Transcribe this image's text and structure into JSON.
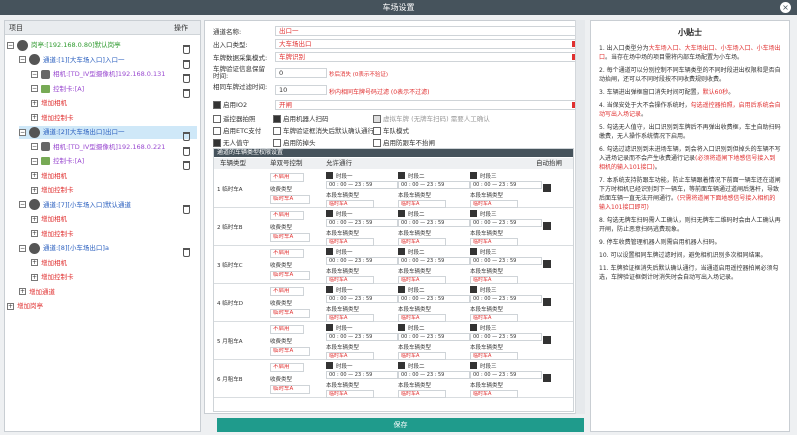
{
  "window": {
    "title": "车场设置",
    "close": "×"
  },
  "left": {
    "col_item": "项目",
    "col_op": "操作",
    "nodes": [
      {
        "text": "岗亭:[192.168.0.80]默认岗亭",
        "color": "green",
        "indent": 0,
        "icon": "booth"
      },
      {
        "text": "通道:[1][大车场入口]入口一",
        "color": "blue",
        "indent": 1,
        "icon": "gate"
      },
      {
        "text": "相机:[TD_IV型摄像机]192.168.0.131",
        "color": "purple",
        "indent": 2,
        "icon": "camera"
      },
      {
        "text": "控制卡:[A]",
        "color": "purple",
        "indent": 2,
        "icon": "card"
      },
      {
        "text": "增加相机",
        "color": "red",
        "indent": 2,
        "icon": "add"
      },
      {
        "text": "增加控制卡",
        "color": "red",
        "indent": 2,
        "icon": "add"
      },
      {
        "text": "通道:[2][大车场出口]出口一",
        "color": "blue",
        "indent": 1,
        "icon": "gate"
      },
      {
        "text": "相机:[TD_IV型摄像机]192.168.0.221",
        "color": "purple",
        "indent": 2,
        "icon": "camera"
      },
      {
        "text": "控制卡:[A]",
        "color": "purple",
        "indent": 2,
        "icon": "card"
      },
      {
        "text": "增加相机",
        "color": "red",
        "indent": 2,
        "icon": "add"
      },
      {
        "text": "增加控制卡",
        "color": "red",
        "indent": 2,
        "icon": "add"
      },
      {
        "text": "通道:[7][小车场入口]默认通道",
        "color": "blue",
        "indent": 1,
        "icon": "gate"
      },
      {
        "text": "增加相机",
        "color": "red",
        "indent": 2,
        "icon": "add"
      },
      {
        "text": "增加控制卡",
        "color": "red",
        "indent": 2,
        "icon": "add"
      },
      {
        "text": "通道:[8][小车场出口]a",
        "color": "blue",
        "indent": 1,
        "icon": "gate"
      },
      {
        "text": "增加相机",
        "color": "red",
        "indent": 2,
        "icon": "add"
      },
      {
        "text": "增加控制卡",
        "color": "red",
        "indent": 2,
        "icon": "add"
      },
      {
        "text": "增加通道",
        "color": "red",
        "indent": 1,
        "icon": "add"
      },
      {
        "text": "增加岗亭",
        "color": "red",
        "indent": 0,
        "icon": "add"
      }
    ]
  },
  "form": {
    "channel_name_label": "通道名称:",
    "channel_name": "出口一",
    "io_type_label": "出入口类型:",
    "io_type": "大车场出口",
    "plate_mode_label": "车牌数据采集模式:",
    "plate_mode": "车牌识别",
    "plate_verify_label": "车牌验证信息保留时间:",
    "plate_verify_value": "0",
    "plate_verify_hint": "秒后消失 (0表示不验证)",
    "same_plate_label": "相同车牌过滤时间:",
    "same_plate_value": "10",
    "same_plate_hint": "秒内相同车牌号码过滤 (0表示不过滤)",
    "io2_label": "启用IO2",
    "io2_value": "开闸",
    "opt_remote": "遥控器拍照",
    "opt_robot": "启用机器人扫码",
    "opt_offline": "虚拟车牌 (无牌车扫码) 需要人工确认",
    "opt_etc": "启用ETC支付",
    "opt_auto_confirm": "车牌验证框消失后默认确认通行",
    "opt_plate_mode": "车队模式",
    "opt_unattended": "无人值守",
    "opt_antiback": "启用防掉头",
    "opt_antitail": "启用防跟车不抬闸"
  },
  "table": {
    "title": "通道的车辆类型权限设置",
    "headers": {
      "type": "车辆类型",
      "single": "单双号控制",
      "allow": "允许通行",
      "auto": "自动抬闸"
    },
    "rows": [
      {
        "label": "1 临时车A",
        "single": "不启用",
        "fee": "收费类型",
        "fee_val": "临时车A"
      },
      {
        "label": "2 临时车B",
        "single": "不启用",
        "fee": "收费类型",
        "fee_val": "临时车A"
      },
      {
        "label": "3 临时车C",
        "single": "不启用",
        "fee": "收费类型",
        "fee_val": "临时车A"
      },
      {
        "label": "4 临时车D",
        "single": "不启用",
        "fee": "收费类型",
        "fee_val": "临时车A"
      },
      {
        "label": "5 月租车A",
        "single": "不启用",
        "fee": "收费类型",
        "fee_val": "临时车A"
      },
      {
        "label": "6 月租车B",
        "single": "不启用",
        "fee": "收费类型",
        "fee_val": "临时车A"
      }
    ],
    "slot_names": [
      "时段一",
      "时段二",
      "时段三"
    ],
    "slot_time": "00 : 00 — 23 : 59",
    "slot_count_label": "本段车辆类型",
    "slot_count_val": "临时车A"
  },
  "save": "保存",
  "tips": {
    "title": "小贴士",
    "items": [
      {
        "n": "1.",
        "t": "出入口类型分为",
        "r": "大车场入口、大车场出口、小车场入口、小车场出口",
        "t2": "。当存在场中场的项目需将内部车场配置为小车场。"
      },
      {
        "n": "2.",
        "t": "每个通道可以分别控制不同车辆类型的不同时段进出权限和是否自动抬闸，还可以不同时段按不同收费规则收费。",
        "r": "",
        "t2": ""
      },
      {
        "n": "3.",
        "t": "车辆进出弹框窗口消失时间可配置，",
        "r": "默认60秒",
        "t2": "。"
      },
      {
        "n": "4.",
        "t": "当保安处于大不会操作系统时，",
        "r": "勾选遥控器拍照，启用后系统会自动写出入场记录",
        "t2": "。"
      },
      {
        "n": "5.",
        "t": "勾选无人值守，出口识别到车牌后不再弹出收费框，车主自助扫码缴费，无人操作系统情况下启用。",
        "r": "",
        "t2": ""
      },
      {
        "n": "6.",
        "t": "勾选过滤识别到未进场车辆，到会将入口识别到但掉头的车辆不写入进场记录而不会产生收费通行记录",
        "r": "(必须将道闸下地感信号接入到相机的输入101接口)",
        "t2": "。"
      },
      {
        "n": "7.",
        "t": "本系统支持防跟车功能，防止车辆跟着情况下前面一辆车还在道闸下方时相机已经识别到下一辆车，等前面车辆通过道闸后落杆，导致后面车辆一直无法开闸通行。",
        "r": "(只需将道闸下面地感信号接入相机的输入101接口即可)",
        "t2": ""
      },
      {
        "n": "8.",
        "t": "勾选无牌车扫码需人工确认，则扫无牌车二维码时会由人工确认再开闸，防止恶意扫码逃费现象。",
        "r": "",
        "t2": ""
      },
      {
        "n": "9.",
        "t": "停车收费管理机器人则需启用机器人扫码。",
        "r": "",
        "t2": ""
      },
      {
        "n": "10.",
        "t": "可以设置相同车牌过滤时间，避免相机识别多次相同结果。",
        "r": "",
        "t2": ""
      },
      {
        "n": "11.",
        "t": "车牌验证框消失后默认确认通行，当通道启用遥控器拍闸必须勾选，车牌验证框倒计时消失时会自动写出入场记录。",
        "r": "",
        "t2": ""
      }
    ]
  }
}
